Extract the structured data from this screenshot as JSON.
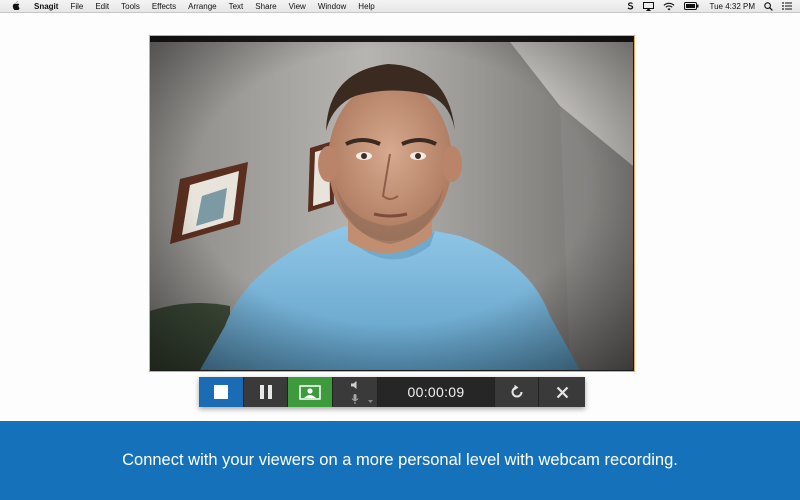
{
  "menubar": {
    "app_name": "Snagit",
    "items": [
      "File",
      "Edit",
      "Tools",
      "Effects",
      "Arrange",
      "Text",
      "Share",
      "View",
      "Window",
      "Help"
    ],
    "clock": "Tue 4:32 PM",
    "tray_icons": [
      "snagit-s-icon",
      "airplay-icon",
      "wifi-icon",
      "battery-icon",
      "search-icon",
      "list-icon"
    ]
  },
  "toolbar": {
    "timer": "00:00:09",
    "stop_color": "#1b6cb5",
    "webcam_color": "#3d9a3d"
  },
  "banner": {
    "text": "Connect with your viewers on a more personal level with webcam recording.",
    "color": "#1572ba"
  }
}
